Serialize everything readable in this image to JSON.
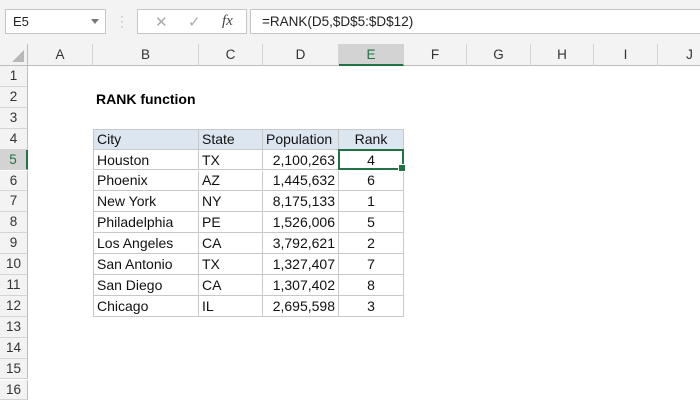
{
  "name_box": "E5",
  "formula": "=RANK(D5,$D$5:$D$12)",
  "formula_buttons": {
    "cancel": "✕",
    "enter": "✓",
    "fx": "fx"
  },
  "columns": [
    "A",
    "B",
    "C",
    "D",
    "E",
    "F",
    "G",
    "H",
    "I",
    "J"
  ],
  "rows": [
    "1",
    "2",
    "3",
    "4",
    "5",
    "6",
    "7",
    "8",
    "9",
    "10",
    "11",
    "12",
    "13",
    "14",
    "15",
    "16"
  ],
  "selected_cell": "E5",
  "title": "RANK function",
  "table": {
    "headers": [
      "City",
      "State",
      "Population",
      "Rank"
    ],
    "rows": [
      [
        "Houston",
        "TX",
        "2,100,263",
        "4"
      ],
      [
        "Phoenix",
        "AZ",
        "1,445,632",
        "6"
      ],
      [
        "New York",
        "NY",
        "8,175,133",
        "1"
      ],
      [
        "Philadelphia",
        "PE",
        "1,526,006",
        "5"
      ],
      [
        "Los Angeles",
        "CA",
        "3,792,621",
        "2"
      ],
      [
        "San Antonio",
        "TX",
        "1,327,407",
        "7"
      ],
      [
        "San Diego",
        "CA",
        "1,307,402",
        "8"
      ],
      [
        "Chicago",
        "IL",
        "2,695,598",
        "3"
      ]
    ]
  },
  "colors": {
    "accent": "#217346",
    "header_fill": "#dce6f1"
  }
}
